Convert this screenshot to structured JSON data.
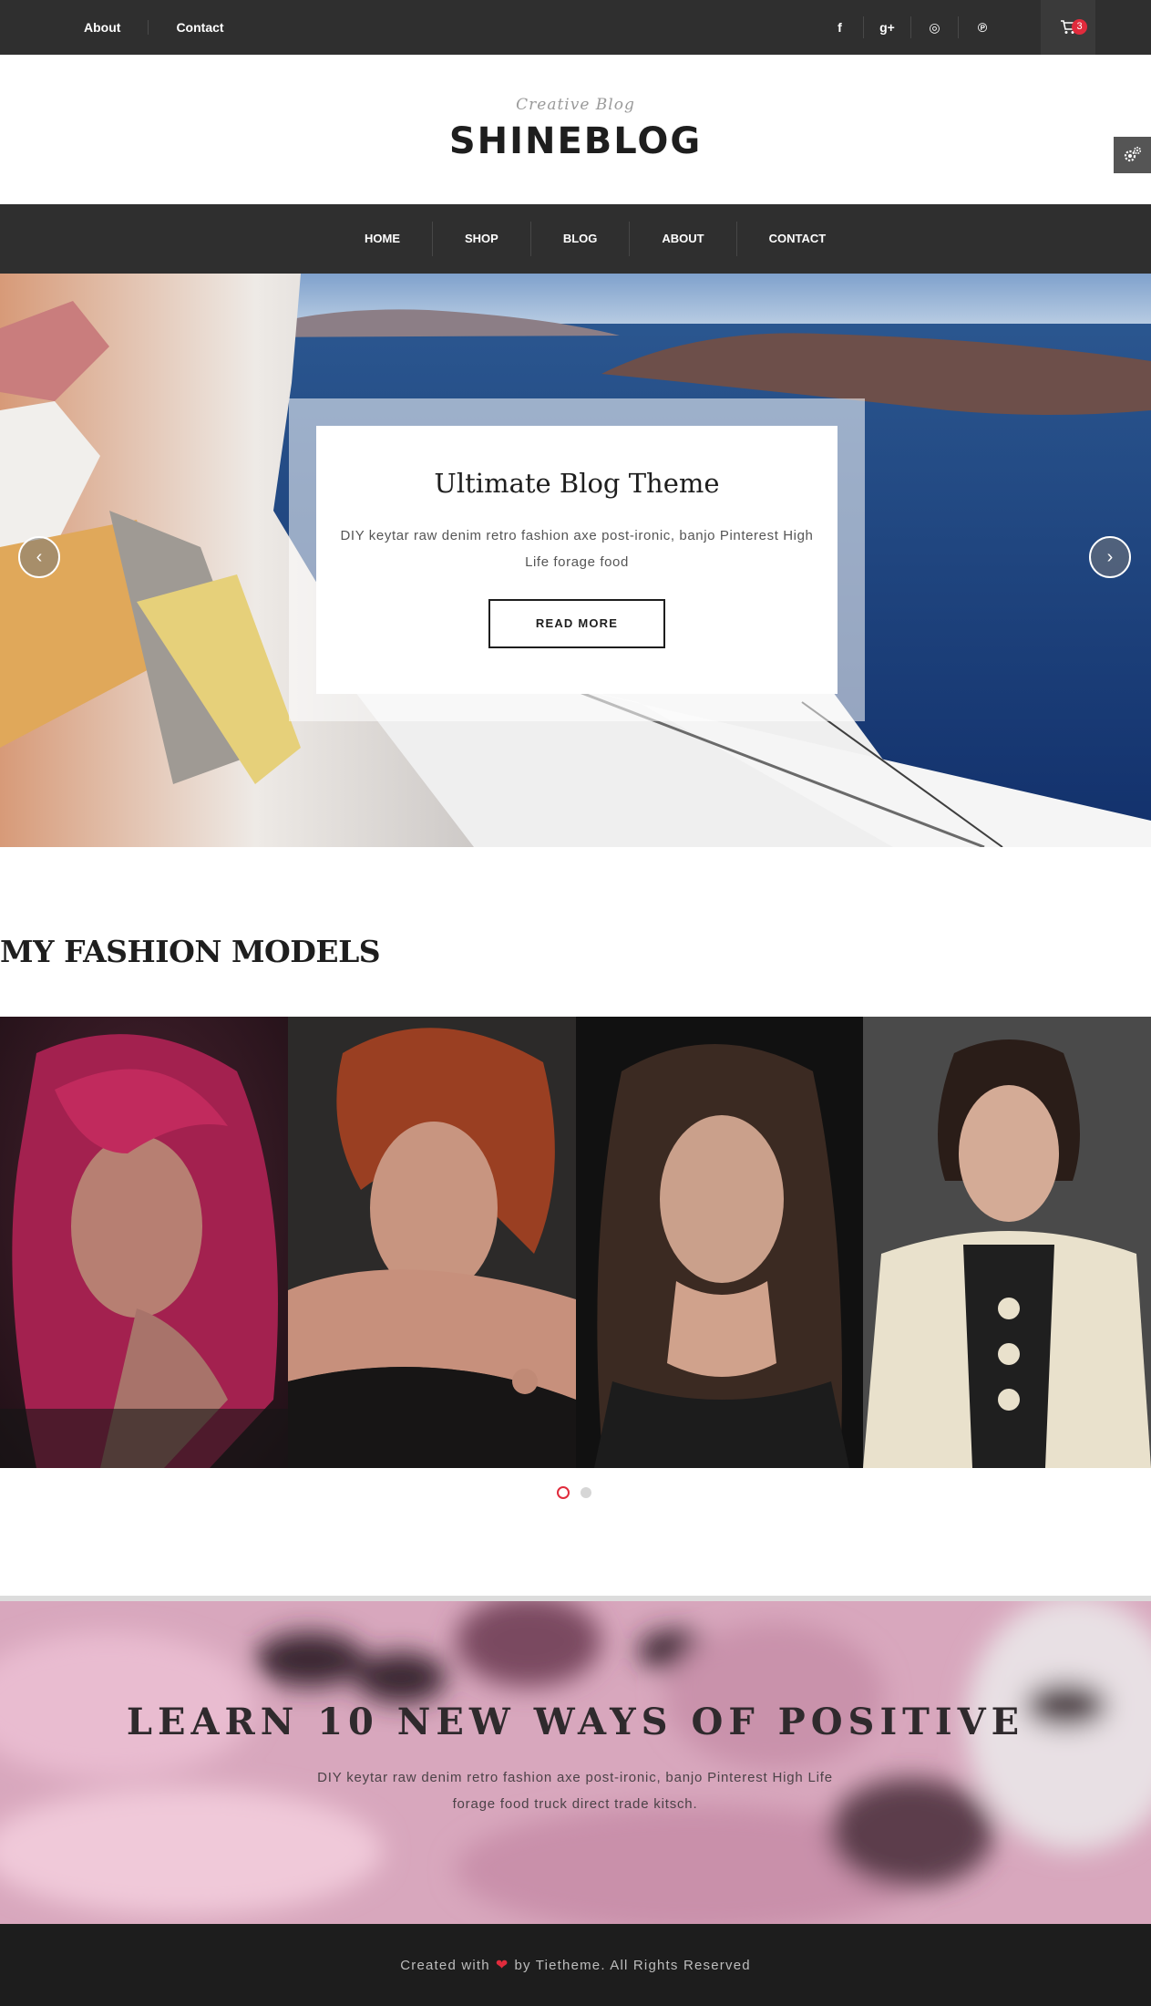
{
  "topbar": {
    "links": [
      {
        "label": "About"
      },
      {
        "label": "Contact"
      }
    ],
    "socials": [
      {
        "icon": "facebook-icon",
        "glyph": "f"
      },
      {
        "icon": "google-plus-icon",
        "glyph": "g+"
      },
      {
        "icon": "dribbble-icon",
        "glyph": "◎"
      },
      {
        "icon": "pinterest-icon",
        "glyph": "℗"
      }
    ],
    "cart": {
      "icon": "cart-icon",
      "count": "3"
    }
  },
  "branding": {
    "tagline": "Creative Blog",
    "title": "SHINEBLOG"
  },
  "nav": {
    "items": [
      {
        "label": "HOME"
      },
      {
        "label": "SHOP"
      },
      {
        "label": "BLOG"
      },
      {
        "label": "ABOUT"
      },
      {
        "label": "CONTACT"
      }
    ]
  },
  "hero": {
    "title": "Ultimate Blog Theme",
    "text": "DIY keytar raw denim retro fashion axe post-ironic, banjo Pinterest High Life forage food",
    "button": "READ MORE",
    "prev_glyph": "‹",
    "next_glyph": "›"
  },
  "models": {
    "title": "MY FASHION MODELS",
    "slides_total": 2,
    "active_slide": 1
  },
  "promo": {
    "title": "LEARN 10 NEW WAYS OF POSITIVE",
    "text": "DIY keytar raw denim retro fashion axe post-ironic, banjo Pinterest High Life forage food truck direct trade kitsch."
  },
  "footer": {
    "prefix": "Created with",
    "suffix": "by Tietheme. All Rights Reserved"
  },
  "colors": {
    "dark_bar": "#2f2f2f",
    "accent": "#e02b3c",
    "footer": "#1d1d1d"
  }
}
